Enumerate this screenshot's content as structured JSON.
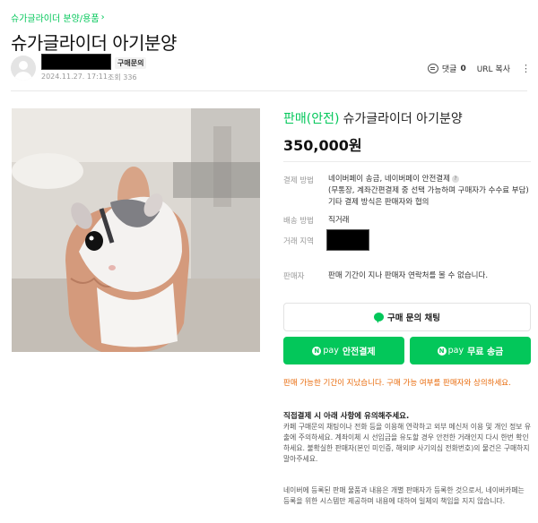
{
  "breadcrumb": {
    "label": "슈가글라이더 분양/용품"
  },
  "post": {
    "title": "슈가글라이더 아기분양"
  },
  "author": {
    "badge": "구매문의",
    "date": "2024.11.27. 17:11",
    "views": "조회 336"
  },
  "actions": {
    "comment_label": "댓글",
    "comment_count": "0",
    "url_copy": "URL 복사"
  },
  "product": {
    "status": "판매(안전)",
    "name": "슈가글라이더 아기분양",
    "price": "350,000원"
  },
  "details": {
    "payment_label": "결제 방법",
    "payment_line1": "네이버페이 송금, 네이버페이 안전결제",
    "payment_line2": "(무통장, 계좌간편결제 중 선택 가능하며 구매자가 수수료 부담) 기타 결제 방식은 판매자와 협의",
    "delivery_label": "배송 방법",
    "delivery_value": "직거래",
    "area_label": "거래 지역",
    "seller_label": "판매자",
    "seller_value": "판매 기간이 지나 판매자 연락처를 볼 수 없습니다."
  },
  "buttons": {
    "chat": "구매 문의 채팅",
    "npay_word": "pay",
    "safe_pay": "안전결제",
    "free_transfer": "무료 송금"
  },
  "notice": "판매 가능한 기간이 지났습니다. 구매 가능 여부를 판매자와 상의하세요.",
  "caution": {
    "title": "직접결제 시 아래 사항에 유의해주세요.",
    "text": "카페 구매문의 채팅이나 전화 등을 이용해 연락하고 외부 메신저 이용 및 개인 정보 유출에 주의하세요. 계좌이체 시 선입금을 유도할 경우 안전한 거래인지 다시 한번 확인하세요. 불확실한 판매자(본인 미인증, 해외IP 사기의심 전화번호)의 물건은 구매하지 말아주세요."
  },
  "disclaimer": "네이버에 등록된 판매 물품과 내용은 개별 판매자가 등록한 것으로서, 네이버카페는 등록을 위한 시스템만 제공하며 내용에 대하여 일체의 책임을 지지 않습니다.",
  "colors": {
    "accent": "#03c75a",
    "notice": "#e96b0c"
  }
}
